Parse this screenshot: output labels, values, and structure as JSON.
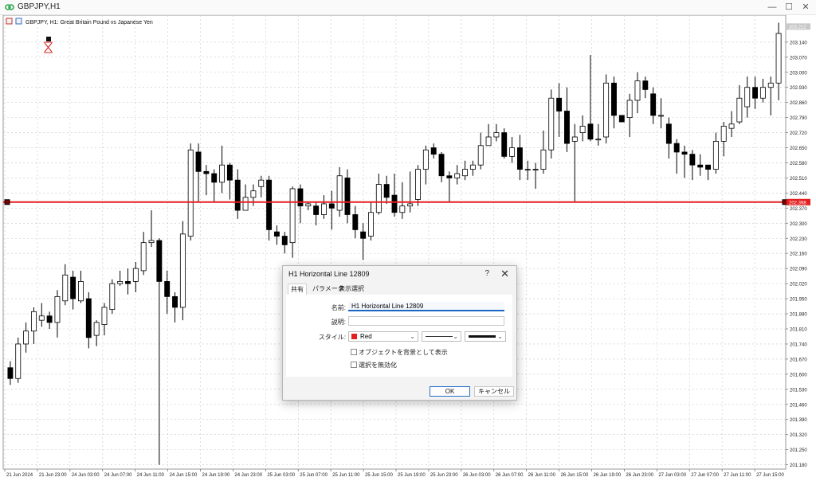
{
  "window": {
    "title": "GBPJPY,H1",
    "minimize_icon": "minimize-icon",
    "maximize_icon": "maximize-icon",
    "close_icon": "close-icon"
  },
  "chart_header": {
    "symbol_text": "GBPJPY, H1:  Great Britain Pound vs Japanese Yen"
  },
  "horizontal_line": {
    "price": 202.398,
    "price_label": "202.398",
    "color": "#e41e1e"
  },
  "current_price_label": "203.212",
  "colors": {
    "bull_body": "#ffffff",
    "bear_body": "#000000",
    "grid": "#c8c8c8",
    "line": "#e41e1e",
    "accent": "#1a66c2"
  },
  "chart_data": {
    "type": "candlestick",
    "y_ticks": [
      "203.140",
      "203.070",
      "203.000",
      "202.930",
      "202.860",
      "202.790",
      "202.720",
      "202.650",
      "202.580",
      "202.510",
      "202.440",
      "202.370",
      "202.300",
      "202.230",
      "202.160",
      "202.090",
      "202.020",
      "201.950",
      "201.880",
      "201.810",
      "201.740",
      "201.670",
      "201.600",
      "201.530",
      "201.460",
      "201.390",
      "201.320",
      "201.250",
      "201.180"
    ],
    "x_ticks": [
      "21 Jun 2024",
      "21 Jun 23:00",
      "24 Jun 03:00",
      "24 Jun 07:00",
      "24 Jun 11:00",
      "24 Jun 15:00",
      "24 Jun 19:00",
      "24 Jun 23:00",
      "25 Jun 03:00",
      "25 Jun 07:00",
      "25 Jun 11:00",
      "25 Jun 15:00",
      "25 Jun 19:00",
      "25 Jun 23:00",
      "26 Jun 03:00",
      "26 Jun 07:00",
      "26 Jun 11:00",
      "26 Jun 15:00",
      "26 Jun 19:00",
      "26 Jun 23:00",
      "27 Jun 03:00",
      "27 Jun 07:00",
      "27 Jun 11:00",
      "27 Jun 15:00"
    ],
    "ylim": [
      201.16,
      203.265
    ],
    "candles": [
      [
        201.63,
        201.58,
        201.66,
        201.55
      ],
      [
        201.58,
        201.74,
        201.77,
        201.56
      ],
      [
        201.74,
        201.8,
        201.84,
        201.7
      ],
      [
        201.8,
        201.89,
        201.91,
        201.74
      ],
      [
        201.85,
        201.87,
        201.93,
        201.82
      ],
      [
        201.87,
        201.84,
        201.89,
        201.81
      ],
      [
        201.84,
        201.96,
        201.99,
        201.77
      ],
      [
        201.94,
        202.06,
        202.11,
        201.92
      ],
      [
        202.05,
        201.95,
        202.08,
        201.9
      ],
      [
        201.94,
        202.03,
        202.08,
        201.93
      ],
      [
        201.95,
        201.77,
        201.98,
        201.72
      ],
      [
        201.78,
        201.84,
        201.85,
        201.73
      ],
      [
        201.83,
        201.91,
        201.93,
        201.78
      ],
      [
        201.9,
        202.02,
        202.04,
        201.88
      ],
      [
        202.02,
        202.03,
        202.08,
        202.01
      ],
      [
        202.03,
        202.02,
        202.09,
        201.97
      ],
      [
        202.03,
        202.09,
        202.12,
        201.98
      ],
      [
        202.08,
        202.21,
        202.26,
        202.06
      ],
      [
        202.21,
        202.22,
        202.36,
        202.19
      ],
      [
        202.22,
        202.03,
        202.23,
        201.18
      ],
      [
        202.03,
        201.96,
        202.08,
        201.88
      ],
      [
        201.96,
        201.91,
        201.98,
        201.84
      ],
      [
        201.91,
        202.25,
        202.31,
        201.85
      ],
      [
        202.24,
        202.64,
        202.67,
        202.22
      ],
      [
        202.63,
        202.54,
        202.67,
        202.4
      ],
      [
        202.54,
        202.53,
        202.57,
        202.43
      ],
      [
        202.53,
        202.49,
        202.55,
        202.4
      ],
      [
        202.49,
        202.57,
        202.66,
        202.44
      ],
      [
        202.57,
        202.5,
        202.58,
        202.41
      ],
      [
        202.5,
        202.36,
        202.55,
        202.32
      ],
      [
        202.36,
        202.42,
        202.48,
        202.36
      ],
      [
        202.42,
        202.45,
        202.48,
        202.38
      ],
      [
        202.47,
        202.5,
        202.52,
        202.42
      ],
      [
        202.5,
        202.27,
        202.52,
        202.22
      ],
      [
        202.26,
        202.24,
        202.29,
        202.2
      ],
      [
        202.24,
        202.2,
        202.26,
        202.16
      ],
      [
        202.21,
        202.46,
        202.47,
        202.14
      ],
      [
        202.46,
        202.38,
        202.48,
        202.3
      ],
      [
        202.38,
        202.39,
        202.4,
        202.36
      ],
      [
        202.38,
        202.34,
        202.4,
        202.29
      ],
      [
        202.34,
        202.39,
        202.43,
        202.32
      ],
      [
        202.39,
        202.37,
        202.45,
        202.27
      ],
      [
        202.36,
        202.52,
        202.56,
        202.33
      ],
      [
        202.51,
        202.34,
        202.55,
        202.3
      ],
      [
        202.34,
        202.27,
        202.38,
        202.23
      ],
      [
        202.26,
        202.23,
        202.3,
        202.13
      ],
      [
        202.24,
        202.35,
        202.4,
        202.22
      ],
      [
        202.35,
        202.48,
        202.53,
        202.34
      ],
      [
        202.48,
        202.42,
        202.52,
        202.39
      ],
      [
        202.43,
        202.35,
        202.53,
        202.33
      ],
      [
        202.35,
        202.38,
        202.49,
        202.32
      ],
      [
        202.38,
        202.39,
        202.54,
        202.35
      ],
      [
        202.41,
        202.55,
        202.57,
        202.38
      ],
      [
        202.55,
        202.64,
        202.66,
        202.48
      ],
      [
        202.65,
        202.62,
        202.67,
        202.6
      ],
      [
        202.62,
        202.52,
        202.63,
        202.49
      ],
      [
        202.52,
        202.51,
        202.54,
        202.4
      ],
      [
        202.51,
        202.53,
        202.57,
        202.48
      ],
      [
        202.52,
        202.55,
        202.59,
        202.5
      ],
      [
        202.55,
        202.57,
        202.59,
        202.52
      ],
      [
        202.57,
        202.66,
        202.72,
        202.55
      ],
      [
        202.66,
        202.7,
        202.76,
        202.66
      ],
      [
        202.7,
        202.72,
        202.76,
        202.68
      ],
      [
        202.72,
        202.61,
        202.74,
        202.6
      ],
      [
        202.61,
        202.65,
        202.7,
        202.58
      ],
      [
        202.65,
        202.55,
        202.71,
        202.5
      ],
      [
        202.55,
        202.55,
        202.59,
        202.5
      ],
      [
        202.55,
        202.55,
        202.58,
        202.46
      ],
      [
        202.55,
        202.64,
        202.73,
        202.53
      ],
      [
        202.64,
        202.88,
        202.92,
        202.6
      ],
      [
        202.88,
        202.82,
        202.95,
        202.7
      ],
      [
        202.82,
        202.67,
        202.93,
        202.63
      ],
      [
        202.68,
        202.7,
        202.76,
        202.4
      ],
      [
        202.72,
        202.75,
        202.8,
        202.68
      ],
      [
        202.76,
        202.69,
        203.08,
        202.68
      ],
      [
        202.69,
        202.69,
        202.76,
        202.66
      ],
      [
        202.7,
        202.95,
        202.99,
        202.67
      ],
      [
        202.95,
        202.8,
        202.98,
        202.74
      ],
      [
        202.8,
        202.77,
        202.8,
        202.77
      ],
      [
        202.79,
        202.87,
        202.9,
        202.7
      ],
      [
        202.87,
        202.96,
        203.0,
        202.81
      ],
      [
        202.96,
        202.92,
        202.98,
        202.88
      ],
      [
        202.9,
        202.8,
        202.93,
        202.76
      ],
      [
        202.8,
        202.8,
        202.88,
        202.74
      ],
      [
        202.76,
        202.67,
        202.79,
        202.6
      ],
      [
        202.67,
        202.63,
        202.69,
        202.53
      ],
      [
        202.63,
        202.62,
        202.66,
        202.51
      ],
      [
        202.62,
        202.57,
        202.64,
        202.5
      ],
      [
        202.57,
        202.56,
        202.62,
        202.52
      ],
      [
        202.57,
        202.55,
        202.57,
        202.5
      ],
      [
        202.55,
        202.68,
        202.72,
        202.53
      ],
      [
        202.68,
        202.75,
        202.77,
        202.61
      ],
      [
        202.74,
        202.76,
        202.82,
        202.7
      ],
      [
        202.77,
        202.88,
        202.94,
        202.76
      ],
      [
        202.84,
        202.93,
        202.98,
        202.79
      ],
      [
        202.93,
        202.88,
        202.98,
        202.83
      ],
      [
        202.88,
        202.93,
        202.97,
        202.86
      ],
      [
        202.93,
        202.95,
        202.98,
        202.8
      ],
      [
        202.95,
        203.18,
        203.23,
        202.87
      ]
    ]
  },
  "dialog": {
    "title": "H1 Horizontal Line 12809",
    "help_icon": "?",
    "tabs": [
      "共有",
      "パラメータ",
      "表示選択"
    ],
    "name_label": "名前:",
    "name_value": "H1 Horizontal Line 12809",
    "desc_label": "説明:",
    "desc_value": "",
    "style_label": "スタイル:",
    "color_value": "Red",
    "checkbox_background": "オブジェクトを背景として表示",
    "checkbox_disable": "選択を無効化",
    "ok_label": "OK",
    "cancel_label": "キャンセル"
  }
}
